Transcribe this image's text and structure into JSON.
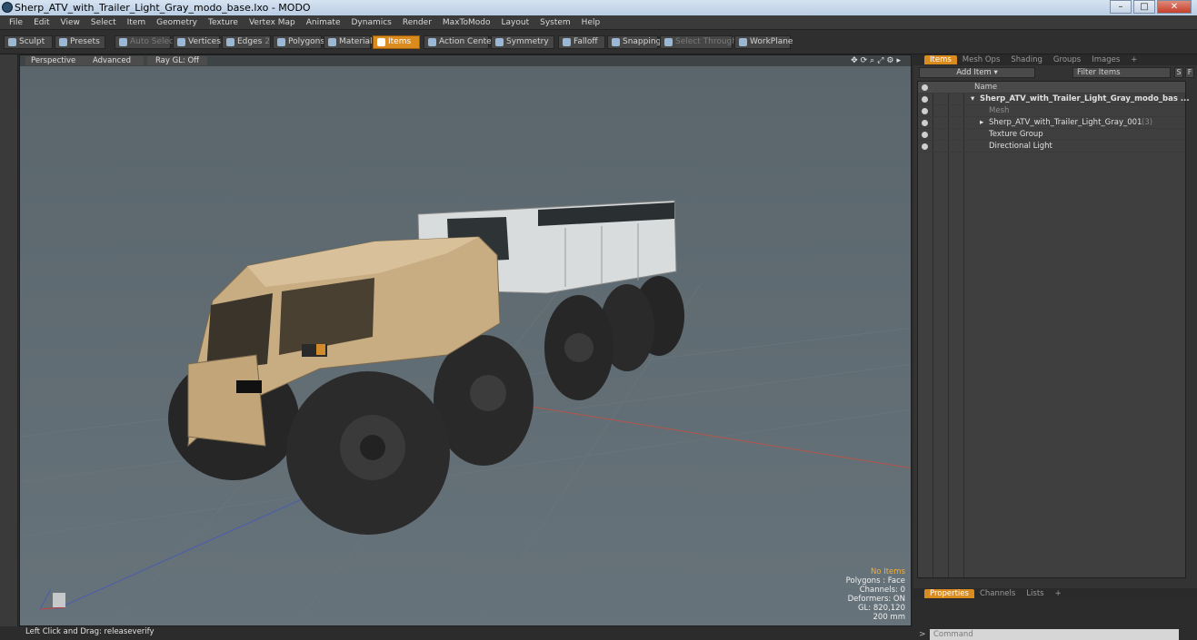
{
  "window": {
    "title": "Sherp_ATV_with_Trailer_Light_Gray_modo_base.lxo - MODO"
  },
  "menu": [
    "File",
    "Edit",
    "View",
    "Select",
    "Item",
    "Geometry",
    "Texture",
    "Vertex Map",
    "Animate",
    "Dynamics",
    "Render",
    "MaxToModo",
    "Layout",
    "System",
    "Help"
  ],
  "toolbar": {
    "sculpt": "Sculpt",
    "presets": "Presets",
    "auto_select": "Auto Select",
    "vertices": "Vertices",
    "edges": "Edges",
    "edges_count": "2",
    "polygons": "Polygons",
    "materials": "Materials",
    "items": "Items",
    "action_center": "Action Center",
    "symmetry": "Symmetry",
    "falloff": "Falloff",
    "snapping": "Snapping",
    "select_through": "Select Through",
    "workplane": "WorkPlane"
  },
  "viewport": {
    "tabs": [
      "Perspective",
      "Advanced",
      "Ray GL: Off"
    ],
    "hud": {
      "no_items": "No Items",
      "polygons": "Polygons : Face",
      "channels": "Channels: 0",
      "deformers": "Deformers: ON",
      "gl": "GL: 820,120",
      "scale": "200 mm"
    }
  },
  "status": {
    "text": "Left Click and Drag:  releaseverify"
  },
  "right_panel": {
    "tabs": [
      "Items",
      "Mesh Ops",
      "Shading",
      "Groups",
      "Images",
      "+"
    ],
    "add_item": "Add Item",
    "filter_items": "Filter Items",
    "s_btn": "S",
    "f_btn": "F",
    "tree": {
      "header": "Name",
      "rows": [
        {
          "label": "Sherp_ATV_with_Trailer_Light_Gray_modo_bas ..."
        },
        {
          "label": "Mesh"
        },
        {
          "label": "Sherp_ATV_with_Trailer_Light_Gray_001",
          "count": "(3)"
        },
        {
          "label": "Texture Group"
        },
        {
          "label": "Directional Light"
        }
      ]
    },
    "bottom_tabs": [
      "Properties",
      "Channels",
      "Lists",
      "+"
    ],
    "command_placeholder": "Command"
  },
  "colors": {
    "accent": "#d98b1e",
    "viewport_bg": "#5e6a70"
  }
}
